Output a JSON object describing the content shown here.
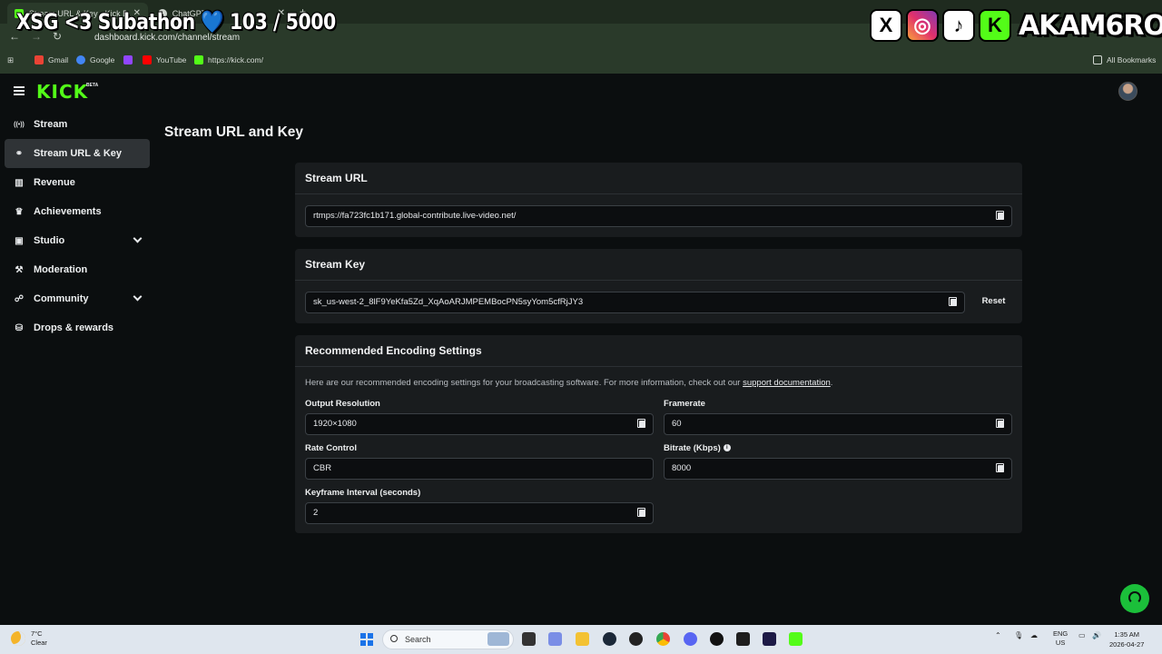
{
  "browser": {
    "tabs": [
      {
        "title": "Stream URL & Key - Kick Dashb",
        "active": true
      },
      {
        "title": "ChatGPT",
        "active": false
      }
    ],
    "url": "dashboard.kick.com/channel/stream",
    "bookmarks": [
      "Gmail",
      "Google",
      "YouTube",
      "https://kick.com/"
    ],
    "all_bookmarks": "All Bookmarks"
  },
  "overlay": {
    "subathon_text": "XSG <3 Subathon",
    "heart": "💙",
    "count": "103 / 5000",
    "handle": "AKAM6RO"
  },
  "app": {
    "logo": "KICK",
    "logo_badge": "BETA"
  },
  "sidebar": {
    "items": [
      {
        "label": "Stream",
        "icon": "broadcast-icon",
        "glyph": "((•))"
      },
      {
        "label": "Stream URL & Key",
        "icon": "link-icon",
        "glyph": "⚭",
        "active": true
      },
      {
        "label": "Revenue",
        "icon": "chart-icon",
        "glyph": "▥"
      },
      {
        "label": "Achievements",
        "icon": "trophy-icon",
        "glyph": "🏆"
      },
      {
        "label": "Studio",
        "icon": "studio-icon",
        "glyph": "▣",
        "expandable": true
      },
      {
        "label": "Moderation",
        "icon": "wrench-icon",
        "glyph": "🔧"
      },
      {
        "label": "Community",
        "icon": "community-icon",
        "glyph": "👥",
        "expandable": true
      },
      {
        "label": "Drops & rewards",
        "icon": "gift-icon",
        "glyph": "⛁"
      }
    ]
  },
  "page": {
    "title": "Stream URL and Key"
  },
  "stream_url": {
    "heading": "Stream URL",
    "value": "rtmps://fa723fc1b171.global-contribute.live-video.net/"
  },
  "stream_key": {
    "heading": "Stream Key",
    "value": "sk_us-west-2_8lF9YeKfa5Zd_XqAoARJMPEMBocPN5syYom5cfRjJY3",
    "reset_label": "Reset"
  },
  "encoding": {
    "heading": "Recommended Encoding Settings",
    "description": "Here are our recommended encoding settings for your broadcasting software. For more information, check out our ",
    "link_text": "support documentation",
    "description_end": ".",
    "fields": {
      "output_resolution": {
        "label": "Output Resolution",
        "value": "1920×1080"
      },
      "framerate": {
        "label": "Framerate",
        "value": "60"
      },
      "rate_control": {
        "label": "Rate Control",
        "value": "CBR"
      },
      "bitrate": {
        "label": "Bitrate (Kbps)",
        "value": "8000"
      },
      "keyframe_interval": {
        "label": "Keyframe Interval (seconds)",
        "value": "2"
      }
    }
  },
  "taskbar": {
    "weather_temp": "7°C",
    "weather_desc": "Clear",
    "search_placeholder": "Search",
    "lang": "ENG",
    "region": "US",
    "time": "1:35 AM",
    "date": "2026-04-27"
  },
  "colors": {
    "kick_green": "#53fc18",
    "background": "#0b0e0f",
    "card": "#191c1e"
  }
}
